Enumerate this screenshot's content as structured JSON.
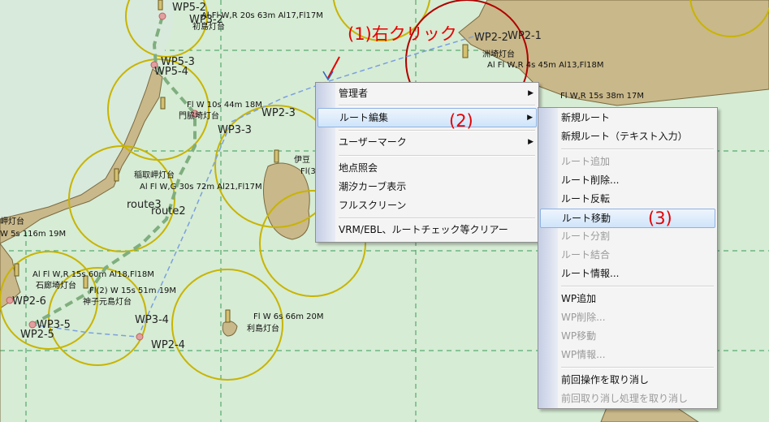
{
  "map": {
    "lighthouses": [
      {
        "name": "初島灯台",
        "info": "Al Fl W,R 20s 63m Al17,Fl17M"
      },
      {
        "name": "洲埼灯台",
        "info": "Al Fl W,R 4s 45m Al13,Fl18M"
      },
      {
        "name": "門脇埼灯台",
        "info": "Fl W 10s 44m 18M"
      },
      {
        "name": "稲取岬灯台",
        "info": "Al Fl W,G 30s 72m Al21,Fl17M"
      },
      {
        "name": "伊豆",
        "info": "Fl(3"
      },
      {
        "name": "石廊埼灯台",
        "info": "Al Fl W,R 15s 60m Al18,Fl18M"
      },
      {
        "name": "神子元島灯台",
        "info": "Fl(2) W 15s 51m 19M"
      },
      {
        "name": "利島灯台",
        "info": "Fl W 6s 66m 20M"
      },
      {
        "name": "岬灯台",
        "info": "W 5s 116m 19M"
      },
      {
        "name": "",
        "info": "Fl W,R 15s 38m 17M"
      }
    ],
    "waypoints": [
      "WP5-2",
      "WP3-2",
      "WP5-3",
      "WP5-4",
      "WP2-3",
      "WP3-3",
      "route3",
      "route2",
      "WP2-6",
      "WP3-5",
      "WP2-5",
      "WP3-4",
      "WP2-4",
      "WP2-2",
      "WP2-1"
    ]
  },
  "annotations": {
    "step1": "(1)右クリック",
    "step2": "(2)",
    "step3": "(3)"
  },
  "context_menu": {
    "items": [
      {
        "label": "管理者",
        "submenu": true
      },
      {
        "label": "ルート編集",
        "submenu": true,
        "highlighted": true
      },
      {
        "label": "ユーザーマーク",
        "submenu": true
      },
      {
        "label": "地点照会"
      },
      {
        "label": "潮汐カーブ表示"
      },
      {
        "label": "フルスクリーン"
      },
      {
        "label": "VRM/EBL、ルートチェック等クリアー"
      }
    ],
    "arrow_glyph": "▶"
  },
  "submenu": {
    "items": [
      {
        "label": "新規ルート"
      },
      {
        "label": "新規ルート（テキスト入力）"
      },
      {
        "label": "ルート追加",
        "disabled": true
      },
      {
        "label": "ルート削除..."
      },
      {
        "label": "ルート反転"
      },
      {
        "label": "ルート移動",
        "highlighted": true
      },
      {
        "label": "ルート分割",
        "disabled": true
      },
      {
        "label": "ルート結合",
        "disabled": true
      },
      {
        "label": "ルート情報..."
      },
      {
        "label": "WP追加"
      },
      {
        "label": "WP削除...",
        "disabled": true
      },
      {
        "label": "WP移動",
        "disabled": true
      },
      {
        "label": "WP情報...",
        "disabled": true
      },
      {
        "label": "前回操作を取り消し"
      },
      {
        "label": "前回取り消し処理を取り消し",
        "disabled": true
      }
    ]
  }
}
